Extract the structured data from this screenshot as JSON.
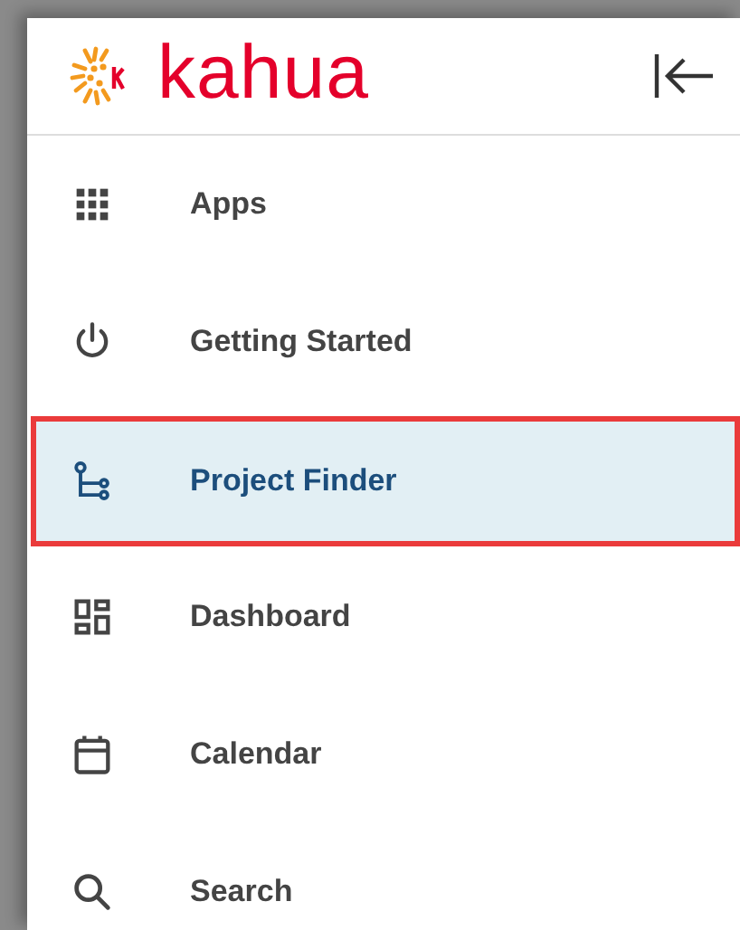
{
  "logo": {
    "text": "kahua"
  },
  "nav": {
    "items": [
      {
        "label": "Apps",
        "selected": false
      },
      {
        "label": "Getting Started",
        "selected": false
      },
      {
        "label": "Project Finder",
        "selected": true
      },
      {
        "label": "Dashboard",
        "selected": false
      },
      {
        "label": "Calendar",
        "selected": false
      },
      {
        "label": "Search",
        "selected": false
      }
    ]
  }
}
